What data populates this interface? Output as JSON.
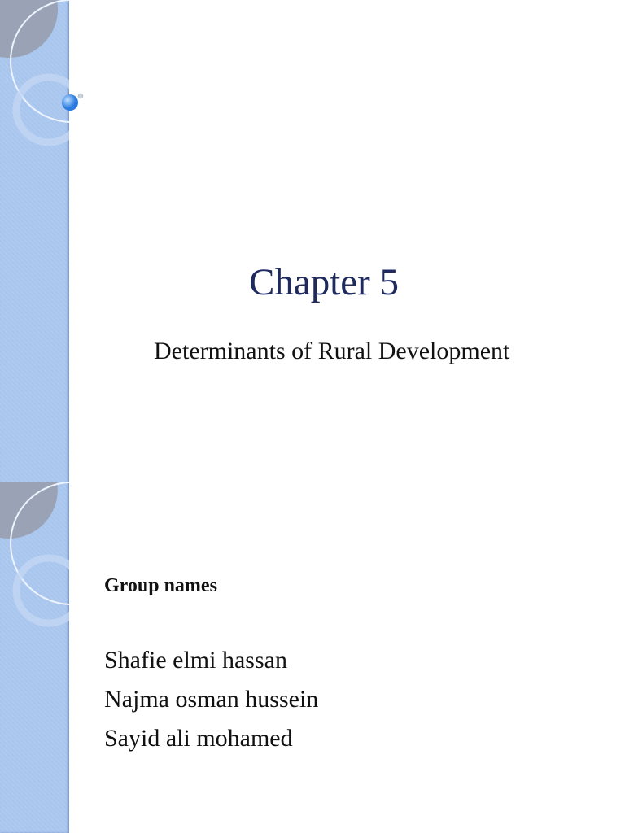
{
  "slide1": {
    "title": "Chapter 5",
    "subtitle": "Determinants of Rural Development"
  },
  "slide2": {
    "heading": "Group names",
    "names": [
      "Shafie elmi hassan",
      "Najma osman hussein",
      "Sayid ali mohamed"
    ]
  },
  "colors": {
    "band": "#a8c5ee",
    "title": "#1f2a5e"
  }
}
